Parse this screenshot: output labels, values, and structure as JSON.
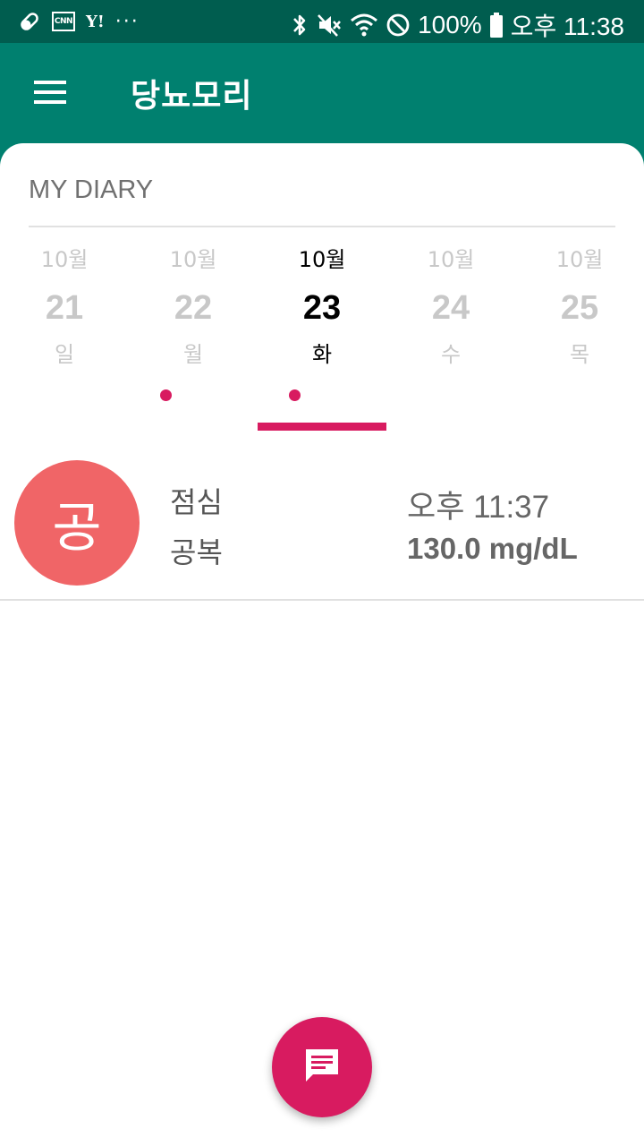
{
  "status_bar": {
    "left_icons": [
      "pill-icon",
      "cnn-icon",
      "yahoo-icon",
      "more-dots-icon"
    ],
    "cnn_label": "CNN",
    "yahoo_label": "Y!",
    "dots_label": "···",
    "right_icons": [
      "bluetooth-icon",
      "mute-icon",
      "wifi-icon",
      "do-not-disturb-icon",
      "battery-icon"
    ],
    "battery_text": "100%",
    "time_text": "오후 11:38"
  },
  "app_bar": {
    "title": "당뇨모리",
    "menu_icon": "hamburger-menu-icon"
  },
  "diary": {
    "header": "MY DIARY",
    "dates": [
      {
        "month": "10월",
        "day": "21",
        "weekday": "일",
        "selected": false,
        "has_entry": false
      },
      {
        "month": "10월",
        "day": "22",
        "weekday": "월",
        "selected": false,
        "has_entry": true
      },
      {
        "month": "10월",
        "day": "23",
        "weekday": "화",
        "selected": true,
        "has_entry": true
      },
      {
        "month": "10월",
        "day": "24",
        "weekday": "수",
        "selected": false,
        "has_entry": false
      },
      {
        "month": "10월",
        "day": "25",
        "weekday": "목",
        "selected": false,
        "has_entry": false
      }
    ]
  },
  "entry": {
    "avatar_letter": "공",
    "meal": "점심",
    "status": "공복",
    "time": "오후 11:37",
    "value": "130.0 mg/dL"
  },
  "fab": {
    "icon": "message-icon"
  },
  "colors": {
    "primary": "#00806f",
    "primary_dark": "#005d4f",
    "accent": "#d81b60",
    "avatar": "#f06567"
  }
}
